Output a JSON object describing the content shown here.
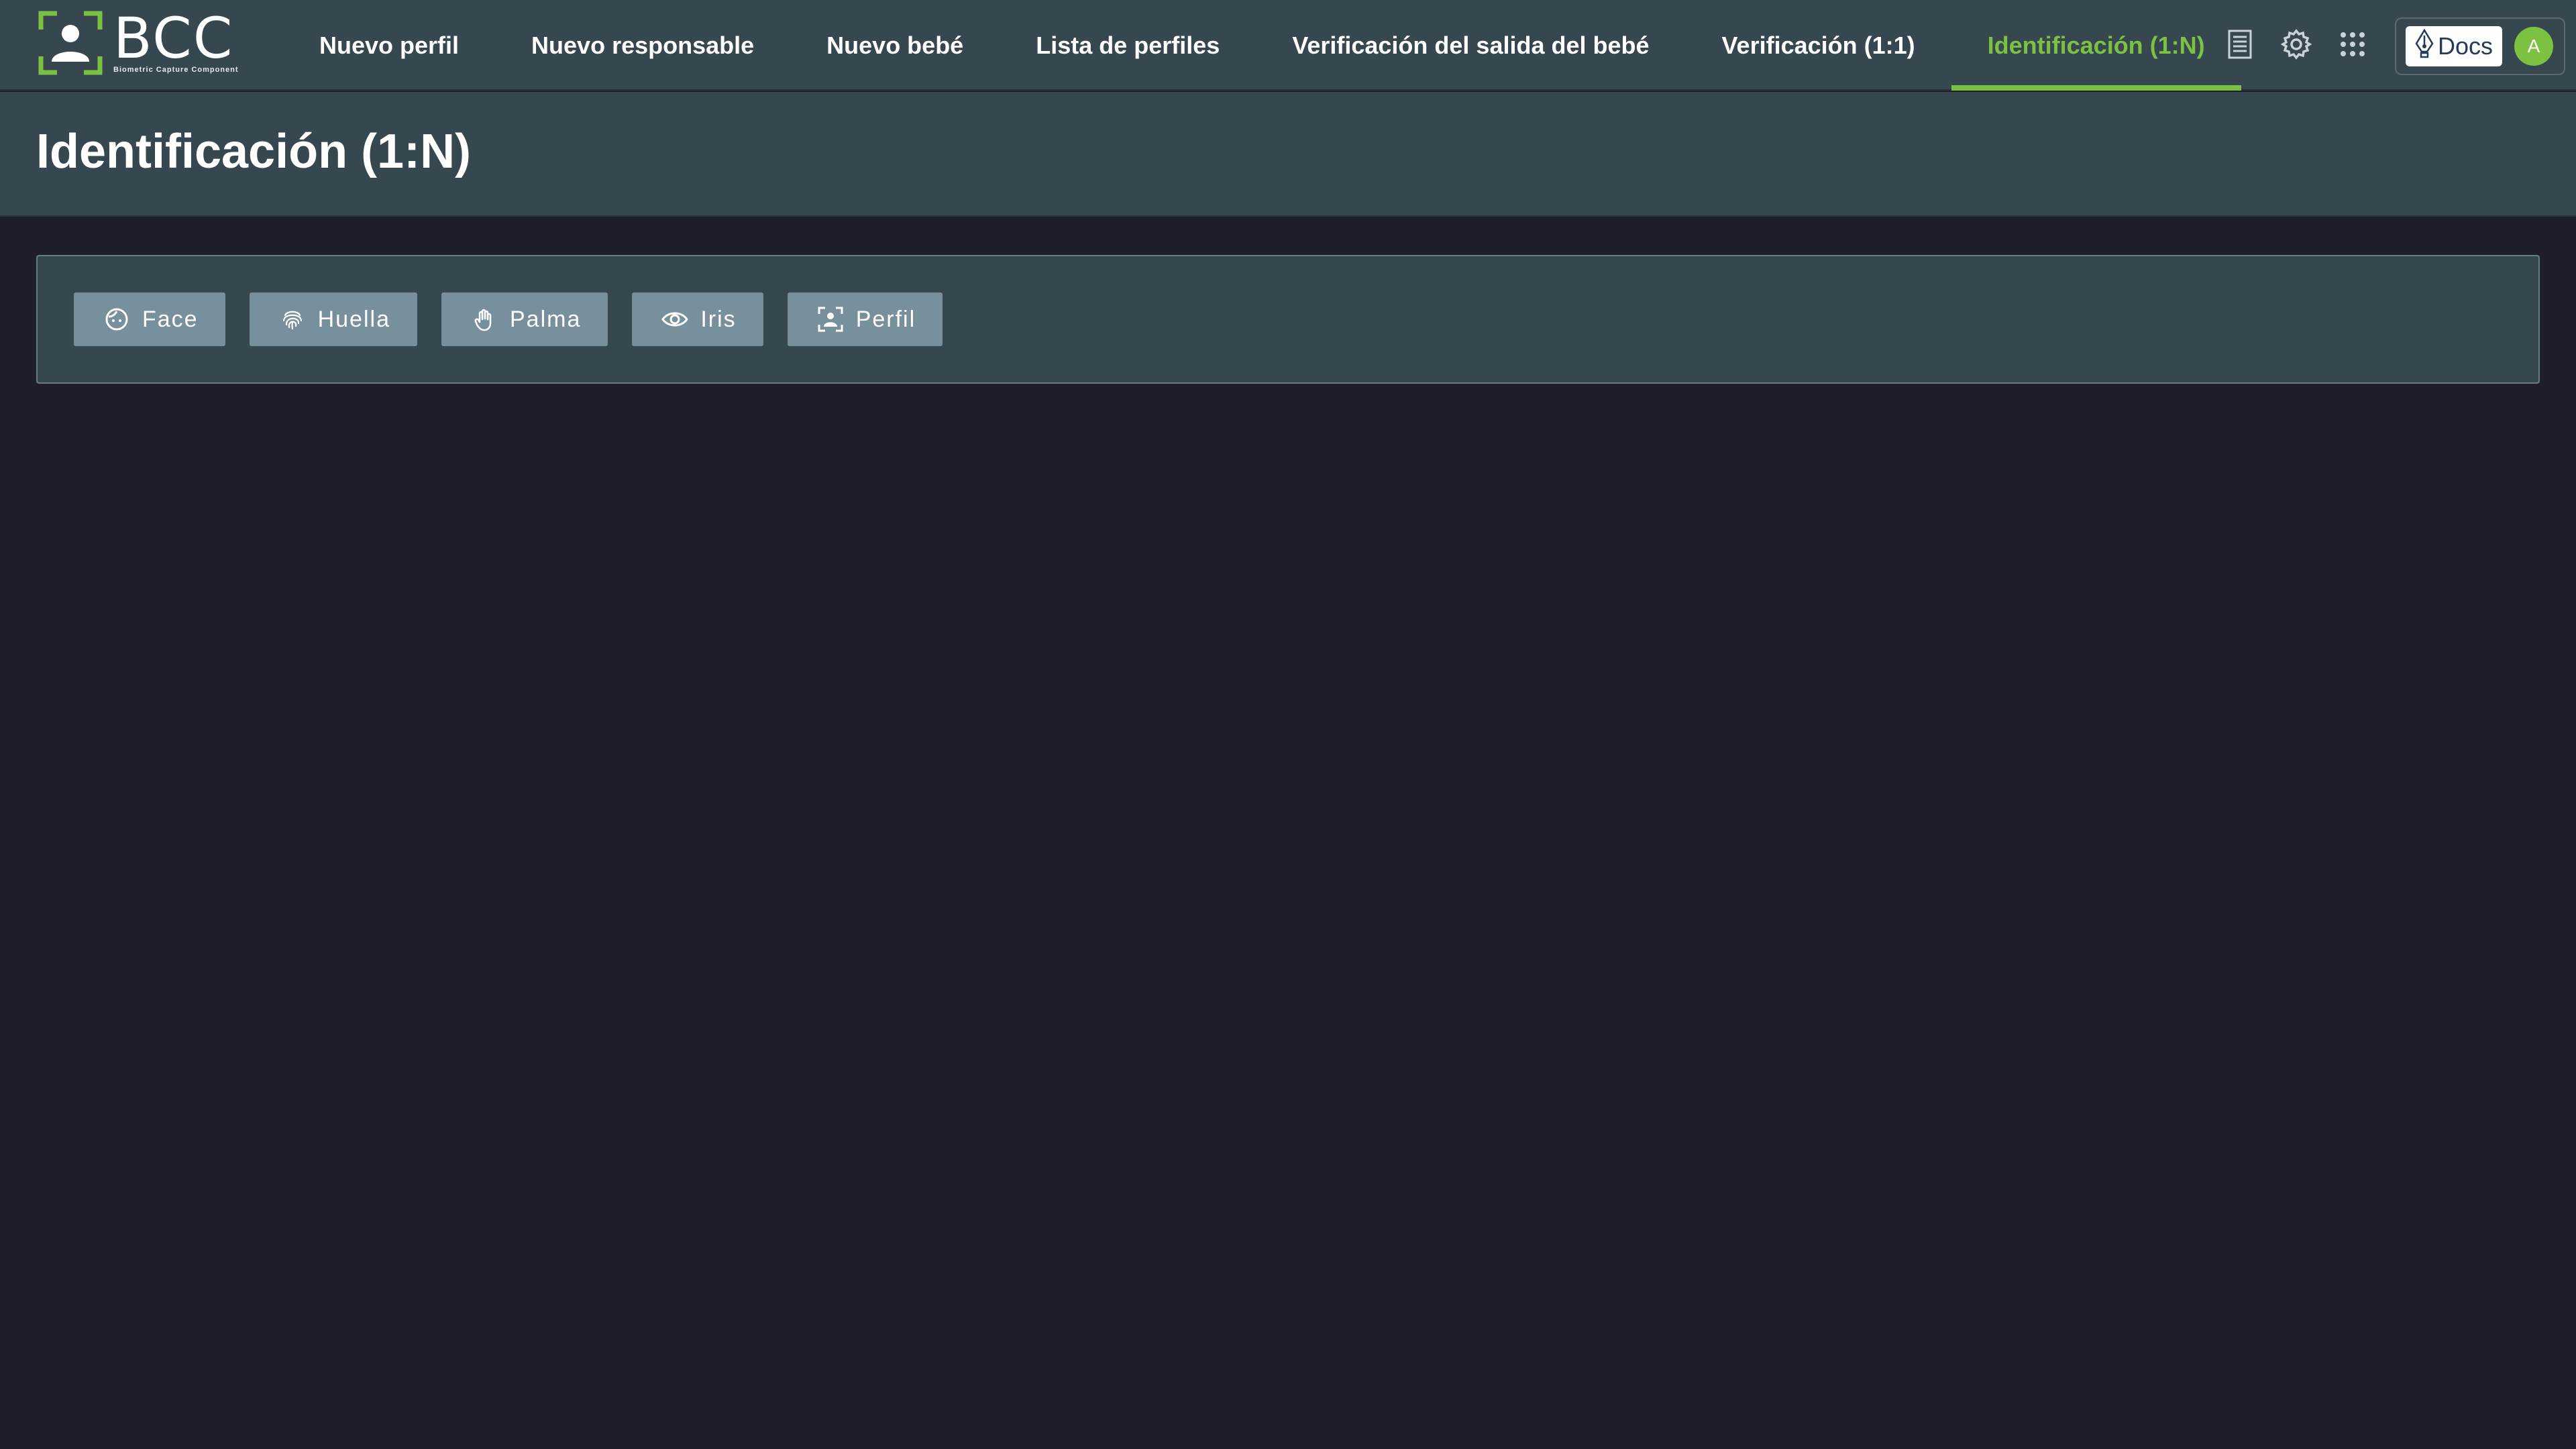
{
  "brand": {
    "name": "BCC",
    "tagline": "Biometric Capture Component"
  },
  "nav": {
    "items": [
      {
        "label": "Nuevo perfil",
        "icon": ""
      },
      {
        "label": "Nuevo responsable"
      },
      {
        "label": "Nuevo bebé"
      },
      {
        "label": "Lista de perfiles"
      },
      {
        "label": "Verificación del salida del bebé"
      },
      {
        "label": "Verificación (1:1)"
      },
      {
        "label": "Identificación (1:N)",
        "active": true
      }
    ]
  },
  "toolbar": {
    "icons": [
      "document-list-icon",
      "gear-icon",
      "apps-grid-icon"
    ]
  },
  "docs": {
    "label": "Docs",
    "icon": "pen-nib-icon"
  },
  "user": {
    "avatar_initial": "A"
  },
  "page": {
    "title": "Identificación (1:N)"
  },
  "modalities": [
    {
      "label": "Face",
      "icon": "face-icon"
    },
    {
      "label": "Huella",
      "icon": "fingerprint-icon"
    },
    {
      "label": "Palma",
      "icon": "palm-icon"
    },
    {
      "label": "Iris",
      "icon": "eye-icon"
    },
    {
      "label": "Perfil",
      "icon": "profile-scan-icon"
    }
  ],
  "colors": {
    "bar": "#37474f",
    "background": "#1c1f29",
    "accent": "#7cc142",
    "button": "#78909c"
  }
}
